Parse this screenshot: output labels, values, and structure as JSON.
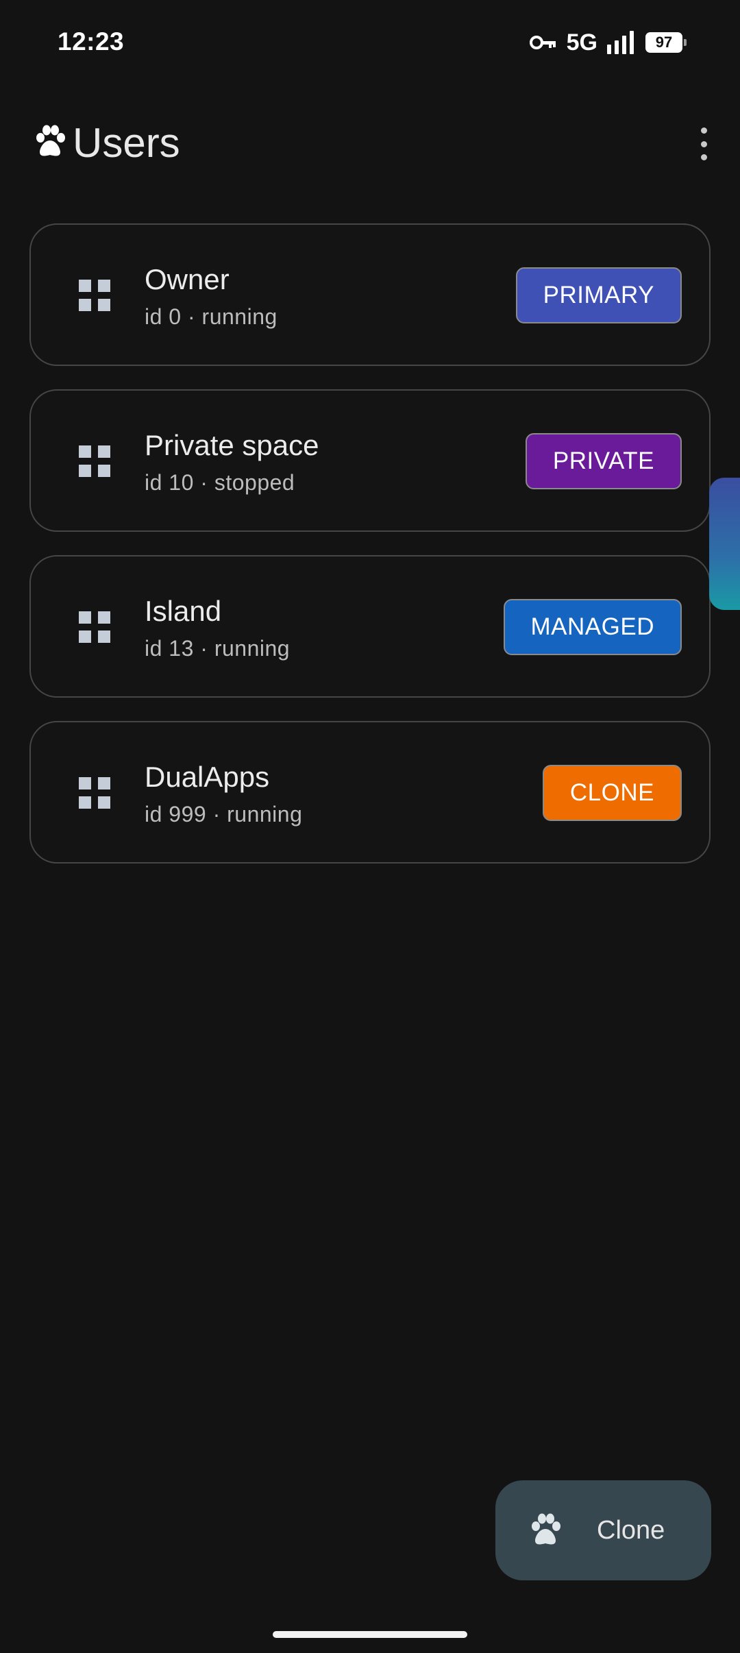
{
  "status_bar": {
    "time": "12:23",
    "network": "5G",
    "battery": "97",
    "icons": [
      "vpn-key-icon",
      "signal-icon",
      "battery-icon"
    ]
  },
  "app_bar": {
    "title": "Users",
    "logo_icon": "paw-icon",
    "menu_icon": "more-vertical-icon"
  },
  "users": [
    {
      "name": "Owner",
      "meta": "id 0 · running",
      "badge": "PRIMARY",
      "badge_color": "#3f51b5"
    },
    {
      "name": "Private space",
      "meta": "id 10 · stopped",
      "badge": "PRIVATE",
      "badge_color": "#6a1b9a"
    },
    {
      "name": "Island",
      "meta": "id 13 · running",
      "badge": "MANAGED",
      "badge_color": "#1565c0"
    },
    {
      "name": "DualApps",
      "meta": "id 999 · running",
      "badge": "CLONE",
      "badge_color": "#ef6c00"
    }
  ],
  "fab": {
    "label": "Clone",
    "icon": "paw-icon"
  }
}
